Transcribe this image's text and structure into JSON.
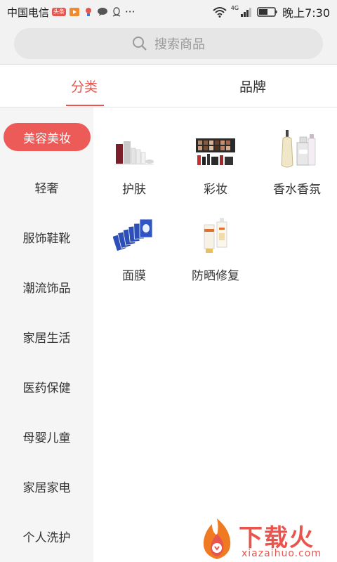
{
  "status_bar": {
    "carrier": "中国电信",
    "badge": "头条",
    "time": "晚上7:30",
    "network": "4G",
    "more": "···"
  },
  "search": {
    "placeholder": "搜索商品"
  },
  "tabs": [
    {
      "label": "分类",
      "active": true
    },
    {
      "label": "品牌",
      "active": false
    }
  ],
  "sidebar": {
    "items": [
      {
        "label": "美容美妆",
        "active": true
      },
      {
        "label": "轻奢"
      },
      {
        "label": "服饰鞋靴"
      },
      {
        "label": "潮流饰品"
      },
      {
        "label": "家居生活"
      },
      {
        "label": "医药保健"
      },
      {
        "label": "母婴儿童"
      },
      {
        "label": "家居家电"
      },
      {
        "label": "个人洗护"
      }
    ]
  },
  "categories": [
    {
      "label": "护肤",
      "icon": "skincare-set-icon"
    },
    {
      "label": "彩妆",
      "icon": "makeup-palette-icon"
    },
    {
      "label": "香水香氛",
      "icon": "perfume-bottles-icon"
    },
    {
      "label": "面膜",
      "icon": "face-mask-packs-icon"
    },
    {
      "label": "防晒修复",
      "icon": "sunscreen-tube-icon"
    }
  ],
  "watermark": {
    "title": "下载火",
    "subtitle": "xiazaihuo.com"
  },
  "colors": {
    "accent": "#e8554e",
    "sidebar_bg": "#f5f5f5",
    "statusbar_bg": "#f2f2f2"
  }
}
